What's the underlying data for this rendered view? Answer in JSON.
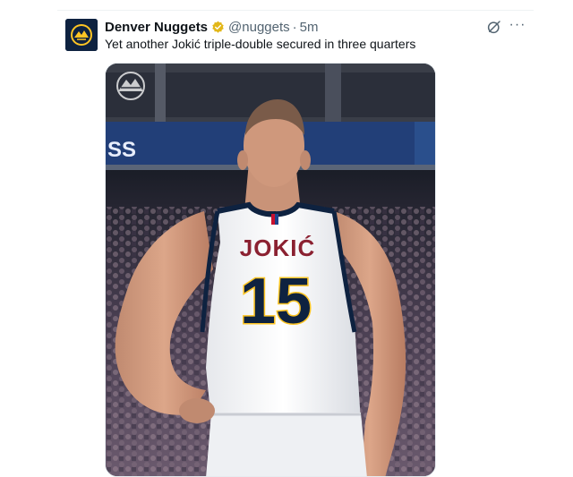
{
  "tweet": {
    "author_name": "Denver Nuggets",
    "handle": "@nuggets",
    "separator": "·",
    "time": "5m",
    "text": "Yet another Jokić triple-double secured in three quarters",
    "more_label": "···",
    "avatar_icon": "nuggets-logo-icon",
    "verified_icon": "gold-verified-badge-icon",
    "grok_icon": "grok-icon"
  },
  "media": {
    "jersey_name": "JOKIĆ",
    "jersey_number": "15",
    "banner_text": "SS",
    "corner_logo_icon": "nuggets-mountain-logo-icon"
  },
  "colors": {
    "navy": "#0e2240",
    "gold": "#fec524",
    "jersey_red": "#8b2131",
    "text_secondary": "#536471"
  }
}
